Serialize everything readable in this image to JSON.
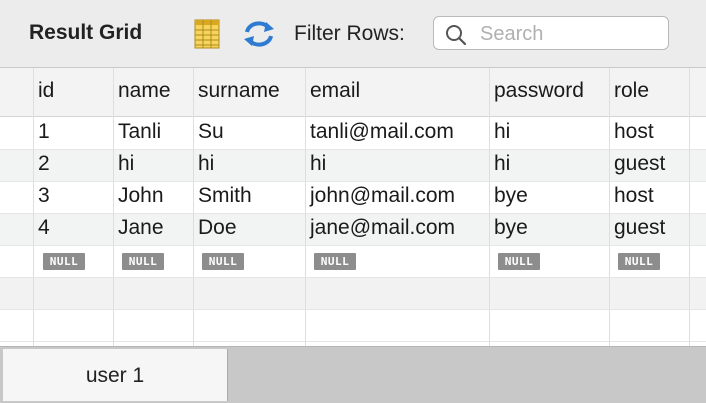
{
  "toolbar": {
    "title": "Result Grid",
    "filter_label": "Filter Rows:",
    "search_placeholder": "Search",
    "search_value": ""
  },
  "columns": [
    "id",
    "name",
    "surname",
    "email",
    "password",
    "role"
  ],
  "rows": [
    [
      "1",
      "Tanli",
      "Su",
      "tanli@mail.com",
      "hi",
      "host"
    ],
    [
      "2",
      "hi",
      "hi",
      "hi",
      "hi",
      "guest"
    ],
    [
      "3",
      "John",
      "Smith",
      "john@mail.com",
      "bye",
      "host"
    ],
    [
      "4",
      "Jane",
      "Doe",
      "jane@mail.com",
      "bye",
      "guest"
    ]
  ],
  "null_label": "NULL",
  "tabs": [
    {
      "label": "user 1"
    }
  ],
  "icons": {
    "grid": "grid-view-icon",
    "refresh": "refresh-icon",
    "search": "search-icon"
  },
  "colors": {
    "null_badge": "#8d8d8d",
    "grid_icon": "#f2c94c",
    "refresh_icon": "#3b82d6"
  }
}
